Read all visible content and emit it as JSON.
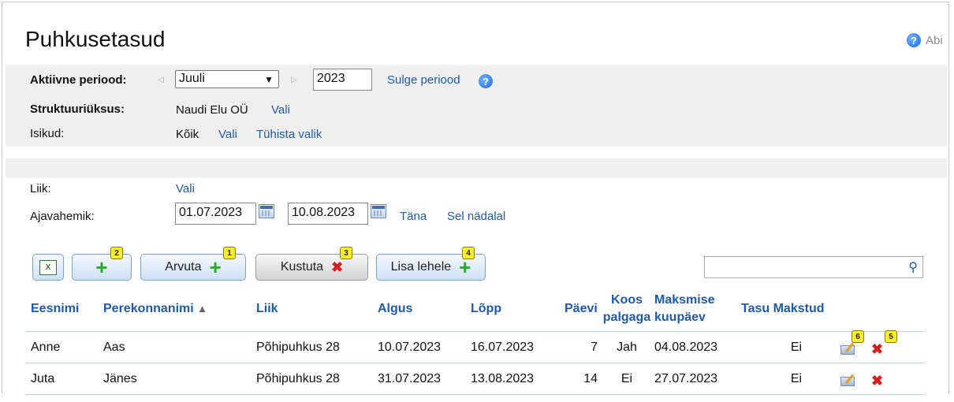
{
  "page": {
    "title": "Puhkusetasud",
    "help_label": "Abi"
  },
  "period": {
    "label": "Aktiivne periood:",
    "month": "Juuli",
    "year": "2023",
    "close_link": "Sulge periood"
  },
  "structure": {
    "label": "Struktuuriüksus:",
    "value": "Naudi Elu OÜ",
    "choose_link": "Vali"
  },
  "persons": {
    "label": "Isikud:",
    "value": "Kõik",
    "choose_link": "Vali",
    "clear_link": "Tühista valik"
  },
  "type_filter": {
    "label": "Liik:",
    "choose_link": "Vali"
  },
  "date_range": {
    "label": "Ajavahemik:",
    "from": "01.07.2023",
    "to": "10.08.2023",
    "today_link": "Täna",
    "this_week_link": "Sel nädalal"
  },
  "toolbar": {
    "excel_icon": "excel-icon",
    "add_badge": "2",
    "calculate_label": "Arvuta",
    "calculate_badge": "1",
    "delete_label": "Kustuta",
    "delete_badge": "3",
    "add_to_page_label": "Lisa lehele",
    "add_to_page_badge": "4",
    "search_value": ""
  },
  "table": {
    "columns": {
      "first_name": "Eesnimi",
      "last_name": "Perekonnanimi",
      "type": "Liik",
      "start": "Algus",
      "end": "Lõpp",
      "days": "Päevi",
      "with_salary_1": "Koos",
      "with_salary_2": "palgaga",
      "payment_date_1": "Maksmise",
      "payment_date_2": "kuupäev",
      "paid": "Tasu Makstud"
    },
    "sort_indicator": "▲",
    "rows": [
      {
        "first_name": "Anne",
        "last_name": "Aas",
        "type": "Põhipuhkus 28",
        "start": "10.07.2023",
        "end": "16.07.2023",
        "days": "7",
        "with_salary": "Jah",
        "payment_date": "04.08.2023",
        "paid": "Ei",
        "edit_badge": "6",
        "delete_badge": "5"
      },
      {
        "first_name": "Juta",
        "last_name": "Jänes",
        "type": "Põhipuhkus 28",
        "start": "31.07.2023",
        "end": "13.08.2023",
        "days": "14",
        "with_salary": "Ei",
        "payment_date": "27.07.2023",
        "paid": "Ei"
      }
    ]
  },
  "colors": {
    "link": "#1f5aa8",
    "panel": "#efefef",
    "add_green": "#2aa92a",
    "delete_red": "#d42020",
    "badge_yellow": "#ffef2a"
  }
}
